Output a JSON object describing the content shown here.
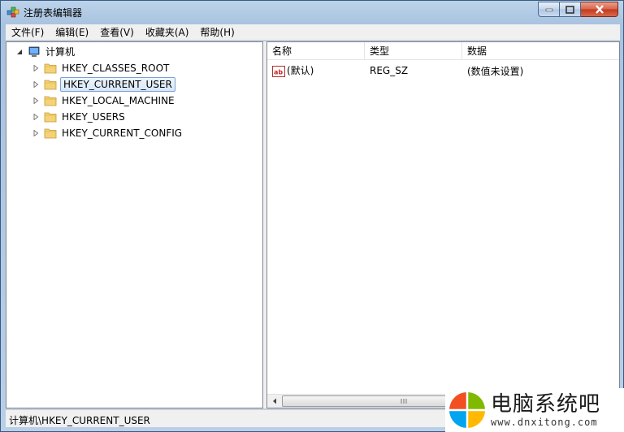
{
  "window": {
    "title": "注册表编辑器"
  },
  "menu": [
    "文件(F)",
    "编辑(E)",
    "查看(V)",
    "收藏夹(A)",
    "帮助(H)"
  ],
  "tree": {
    "root": "计算机",
    "keys": [
      "HKEY_CLASSES_ROOT",
      "HKEY_CURRENT_USER",
      "HKEY_LOCAL_MACHINE",
      "HKEY_USERS",
      "HKEY_CURRENT_CONFIG"
    ],
    "selected": "HKEY_CURRENT_USER"
  },
  "list": {
    "columns": [
      "名称",
      "类型",
      "数据"
    ],
    "rows": [
      {
        "name": "(默认)",
        "type": "REG_SZ",
        "data": "(数值未设置)",
        "icon": "string-value-icon"
      }
    ]
  },
  "status": {
    "path": "计算机\\HKEY_CURRENT_USER"
  },
  "watermark": {
    "title": "电脑系统吧",
    "url": "www.dnxitong.com"
  },
  "colors": {
    "accent": "#7da2ce",
    "logo": [
      "#f25022",
      "#7fba00",
      "#00a4ef",
      "#ffb900"
    ]
  }
}
